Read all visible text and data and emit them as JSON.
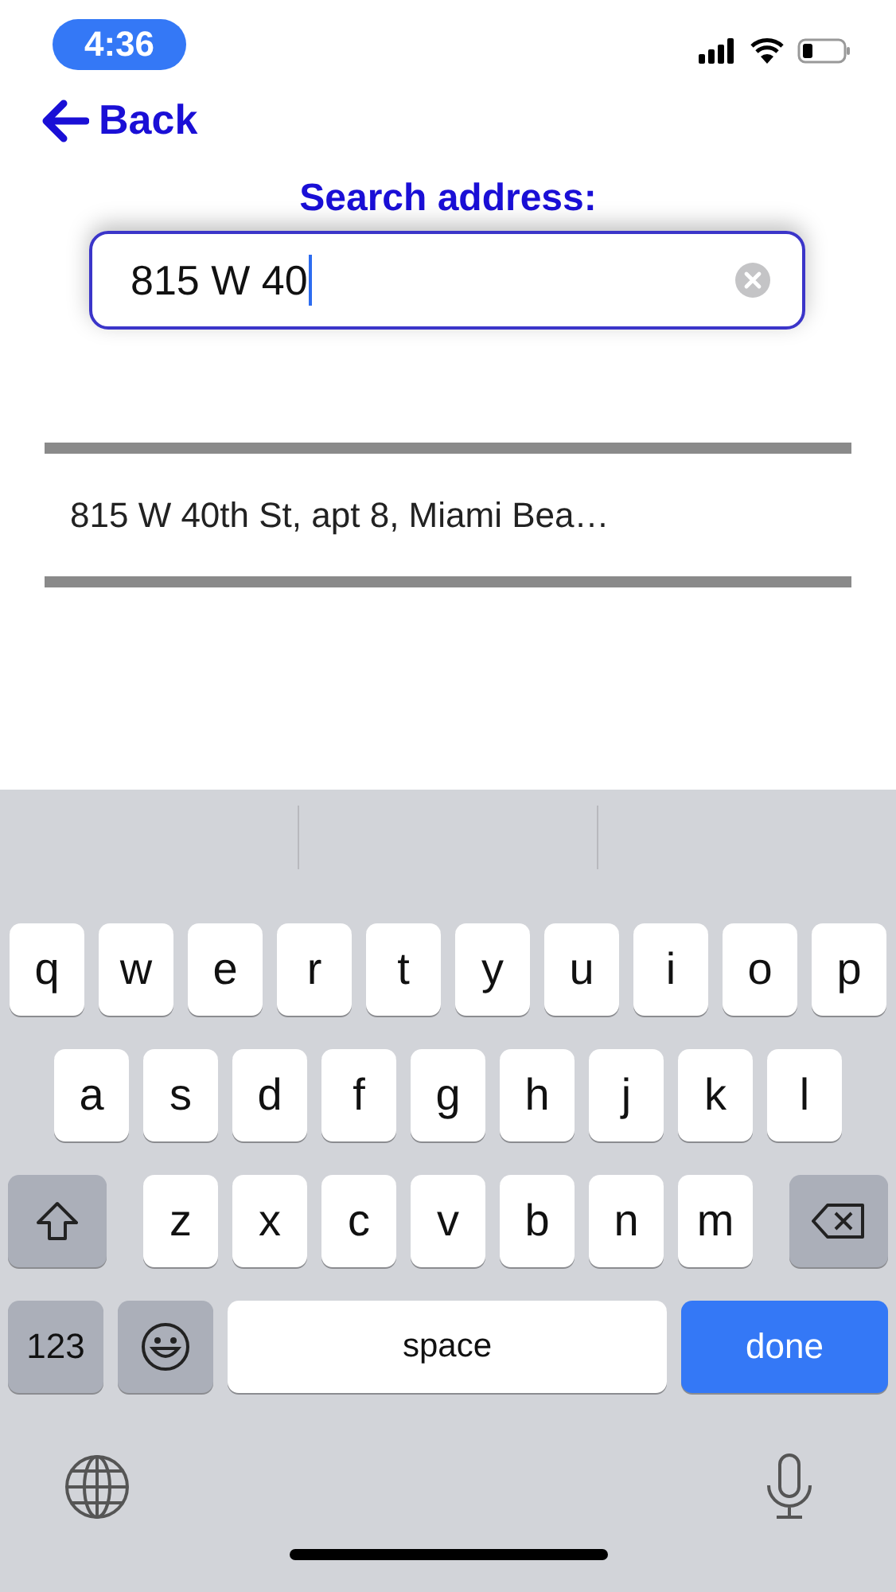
{
  "status_bar": {
    "time": "4:36"
  },
  "back": {
    "label": "Back"
  },
  "search": {
    "label": "Search address:",
    "value": "815 W 40",
    "focused": true
  },
  "results": [
    {
      "text": "815 W 40th St, apt 8, Miami Bea…"
    }
  ],
  "keyboard": {
    "rows": [
      {
        "keys": [
          {
            "kind": "letter",
            "label": "q"
          },
          {
            "kind": "letter",
            "label": "w"
          },
          {
            "kind": "letter",
            "label": "e"
          },
          {
            "kind": "letter",
            "label": "r"
          },
          {
            "kind": "letter",
            "label": "t"
          },
          {
            "kind": "letter",
            "label": "y"
          },
          {
            "kind": "letter",
            "label": "u"
          },
          {
            "kind": "letter",
            "label": "i"
          },
          {
            "kind": "letter",
            "label": "o"
          },
          {
            "kind": "letter",
            "label": "p"
          }
        ]
      },
      {
        "keys": [
          {
            "kind": "letter",
            "label": "a"
          },
          {
            "kind": "letter",
            "label": "s"
          },
          {
            "kind": "letter",
            "label": "d"
          },
          {
            "kind": "letter",
            "label": "f"
          },
          {
            "kind": "letter",
            "label": "g"
          },
          {
            "kind": "letter",
            "label": "h"
          },
          {
            "kind": "letter",
            "label": "j"
          },
          {
            "kind": "letter",
            "label": "k"
          },
          {
            "kind": "letter",
            "label": "l"
          }
        ]
      },
      {
        "keys": [
          {
            "kind": "shift"
          },
          {
            "kind": "letter",
            "label": "z"
          },
          {
            "kind": "letter",
            "label": "x"
          },
          {
            "kind": "letter",
            "label": "c"
          },
          {
            "kind": "letter",
            "label": "v"
          },
          {
            "kind": "letter",
            "label": "b"
          },
          {
            "kind": "letter",
            "label": "n"
          },
          {
            "kind": "letter",
            "label": "m"
          },
          {
            "kind": "backspace"
          }
        ]
      },
      {
        "keys": [
          {
            "kind": "numbers",
            "label": "123"
          },
          {
            "kind": "emoji"
          },
          {
            "kind": "space",
            "label": "space"
          },
          {
            "kind": "done",
            "label": "done"
          }
        ]
      }
    ]
  }
}
